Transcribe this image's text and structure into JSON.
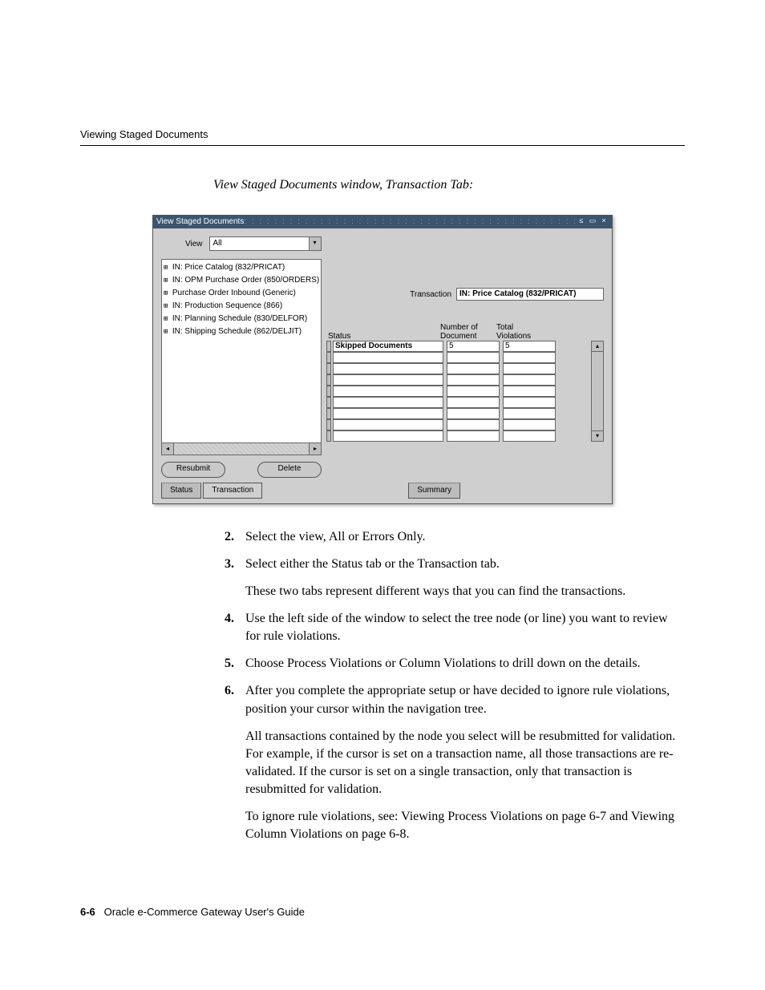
{
  "header": {
    "title": "Viewing Staged Documents"
  },
  "caption": "View Staged Documents window, Transaction Tab:",
  "window": {
    "title": "View Staged Documents",
    "view_label": "View",
    "view_value": "All",
    "tree": [
      "IN: Price Catalog (832/PRICAT)",
      "IN: OPM Purchase Order (850/ORDERS)",
      "Purchase Order Inbound (Generic)",
      "IN: Production Sequence (866)",
      "IN: Planning Schedule (830/DELFOR)",
      "IN: Shipping Schedule (862/DELJIT)"
    ],
    "resubmit_label": "Resubmit",
    "delete_label": "Delete",
    "transaction_label": "Transaction",
    "transaction_value": "IN: Price Catalog (832/PRICAT)",
    "grid_headers": {
      "status": "Status",
      "num1": "Number of",
      "num2": "Document",
      "tot1": "Total",
      "tot2": "Violations"
    },
    "grid_rows": [
      {
        "status": "Skipped Documents",
        "num": "5",
        "tot": "5"
      },
      {
        "status": "",
        "num": "",
        "tot": ""
      },
      {
        "status": "",
        "num": "",
        "tot": ""
      },
      {
        "status": "",
        "num": "",
        "tot": ""
      },
      {
        "status": "",
        "num": "",
        "tot": ""
      },
      {
        "status": "",
        "num": "",
        "tot": ""
      },
      {
        "status": "",
        "num": "",
        "tot": ""
      },
      {
        "status": "",
        "num": "",
        "tot": ""
      },
      {
        "status": "",
        "num": "",
        "tot": ""
      }
    ],
    "tabs": {
      "status": "Status",
      "transaction": "Transaction",
      "summary": "Summary"
    }
  },
  "steps": {
    "s2": "Select the view, All or Errors Only.",
    "s3": "Select either the Status tab or the Transaction tab.",
    "s3b": "These two tabs represent different ways that you can find the transactions.",
    "s4": "Use the left side of the window to select the tree node (or line) you want to review for rule violations.",
    "s5": "Choose Process Violations or Column Violations to drill down on the details.",
    "s6a": "After you complete the appropriate setup or have decided to ignore rule violations, position your cursor within the navigation tree.",
    "s6b": "All transactions contained by the node you select will be resubmitted for validation. For example, if the cursor is set on a transaction name, all those transactions are re-validated. If the cursor is set on a single transaction, only that transaction is resubmitted for validation.",
    "s6c": "To ignore rule violations, see: Viewing Process Violations on page 6-7 and Viewing Column Violations on page 6-8."
  },
  "footer": {
    "page": "6-6",
    "book": "Oracle e-Commerce Gateway User's Guide"
  }
}
